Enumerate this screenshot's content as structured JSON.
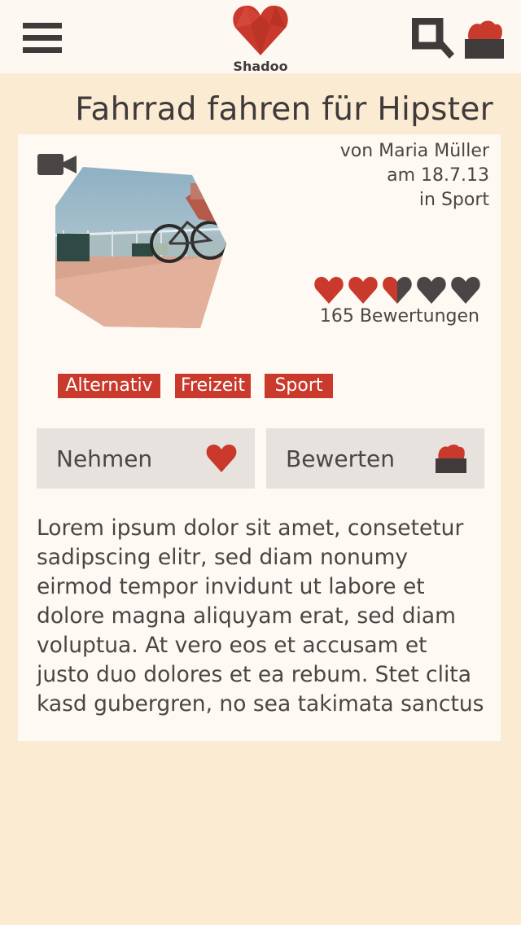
{
  "header": {
    "logo_text": "Shadoo",
    "icons": {
      "menu": "hamburger-menu-icon",
      "search": "search-icon",
      "box": "heart-box-icon"
    }
  },
  "article": {
    "title": "Fahrrad fahren für Hipster",
    "media_icon": "video-camera-icon",
    "author_line": "von Maria Müller",
    "date_line": "am 18.7.13",
    "category_line": "in Sport",
    "rating": {
      "value": 2.5,
      "max": 5
    },
    "ratings_count": "165 Bewertungen",
    "tags": [
      "Alternativ",
      "Freizeit",
      "Sport"
    ],
    "actions": {
      "take_label": "Nehmen",
      "rate_label": "Bewerten"
    },
    "body": "Lorem ipsum dolor sit amet, consetetur\nsadipscing elitr, sed diam nonumy\neirmod tempor invidunt ut labore et\ndolore magna aliquyam erat, sed diam\nvoluptua. At vero eos et accusam et\njusto duo dolores et ea rebum. Stet clita\nkasd gubergren, no sea takimata sanctus"
  },
  "colors": {
    "accent": "#c9392c",
    "dark": "#3f3b3b",
    "page_bg": "#fcebd3",
    "card_bg": "#fef9f2",
    "button_bg": "#e7e2de"
  }
}
